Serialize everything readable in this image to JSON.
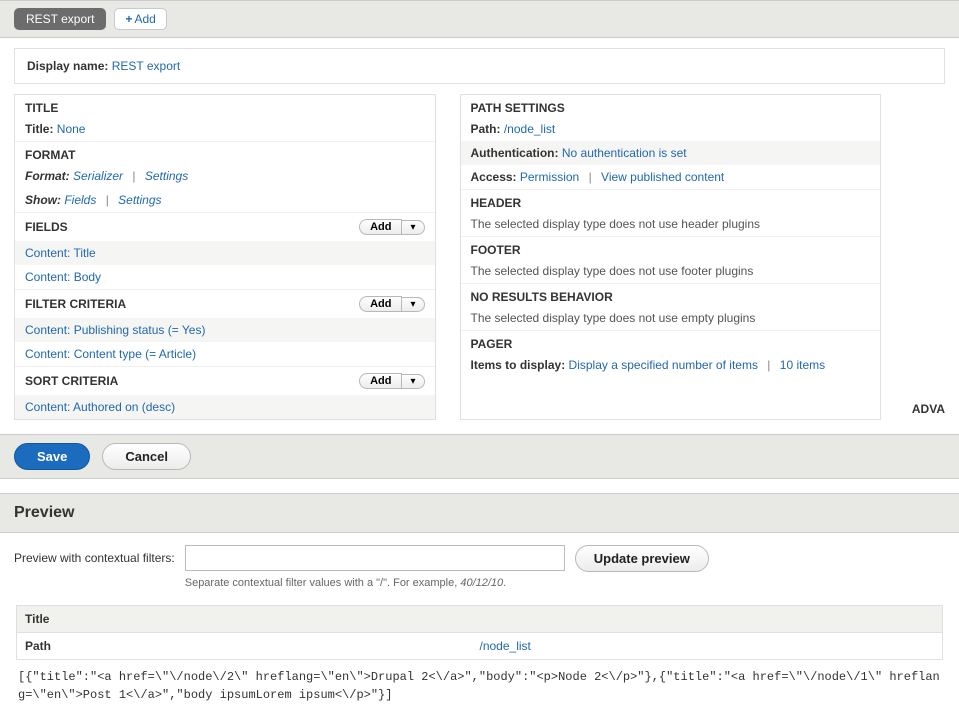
{
  "tabs": {
    "active": "REST export",
    "add_label": "Add"
  },
  "display_name": {
    "label": "Display name:",
    "value": "REST export"
  },
  "left": {
    "title_section": {
      "heading": "TITLE",
      "label": "Title:",
      "value": "None"
    },
    "format_section": {
      "heading": "FORMAT",
      "format_label": "Format:",
      "format_value": "Serializer",
      "format_settings": "Settings",
      "show_label": "Show:",
      "show_value": "Fields",
      "show_settings": "Settings"
    },
    "fields_section": {
      "heading": "FIELDS",
      "add": "Add",
      "items": [
        "Content: Title",
        "Content: Body"
      ]
    },
    "filter_section": {
      "heading": "FILTER CRITERIA",
      "add": "Add",
      "items": [
        "Content: Publishing status (= Yes)",
        "Content: Content type (= Article)"
      ]
    },
    "sort_section": {
      "heading": "SORT CRITERIA",
      "add": "Add",
      "items": [
        "Content: Authored on (desc)"
      ]
    }
  },
  "right": {
    "path_section": {
      "heading": "PATH SETTINGS",
      "path_label": "Path:",
      "path_value": "/node_list",
      "auth_label": "Authentication:",
      "auth_value": "No authentication is set",
      "access_label": "Access:",
      "access_value": "Permission",
      "access_extra": "View published content"
    },
    "header_section": {
      "heading": "HEADER",
      "note": "The selected display type does not use header plugins"
    },
    "footer_section": {
      "heading": "FOOTER",
      "note": "The selected display type does not use footer plugins"
    },
    "noresults_section": {
      "heading": "NO RESULTS BEHAVIOR",
      "note": "The selected display type does not use empty plugins"
    },
    "pager_section": {
      "heading": "PAGER",
      "items_label": "Items to display:",
      "items_value": "Display a specified number of items",
      "items_count": "10 items"
    }
  },
  "advanced_label": "ADVA",
  "buttons": {
    "save": "Save",
    "cancel": "Cancel"
  },
  "preview": {
    "heading": "Preview",
    "filter_label": "Preview with contextual filters:",
    "filter_value": "",
    "update_label": "Update preview",
    "hint_prefix": "Separate contextual filter values with a \"/\". For example, ",
    "hint_example": "40/12/10",
    "hint_suffix": ".",
    "title_col": "Title",
    "path_col": "Path",
    "path_value": "/node_list",
    "json_output": "[{\"title\":\"<a href=\\\"\\/node\\/2\\\" hreflang=\\\"en\\\">Drupal 2<\\/a>\",\"body\":\"<p>Node 2<\\/p>\"},{\"title\":\"<a href=\\\"\\/node\\/1\\\" hreflang=\\\"en\\\">Post 1<\\/a>\",\"body ipsumLorem ipsum<\\/p>\"}]"
  }
}
